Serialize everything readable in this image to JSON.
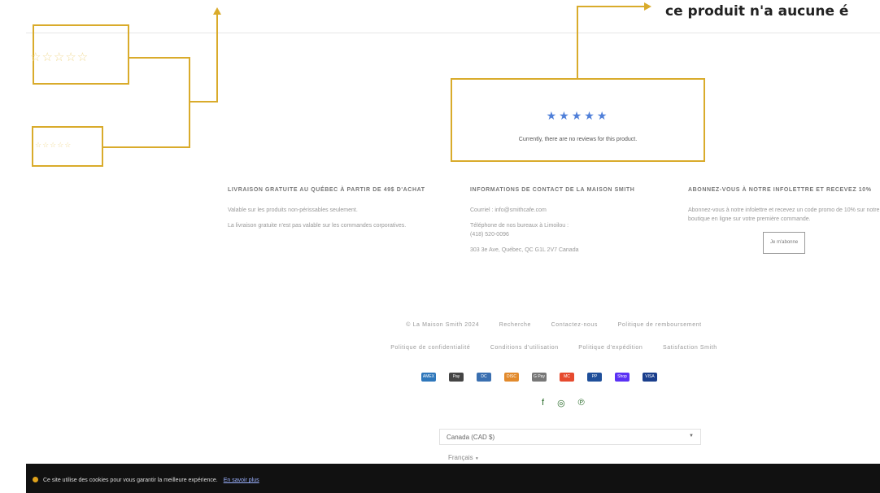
{
  "annotation": {
    "caption": "ce produit n'a aucune é",
    "star_rating_large": "☆☆☆☆☆",
    "star_rating_small": "☆☆☆☆☆",
    "color": "#d9ab2b"
  },
  "reviews": {
    "stars": "★★★★★",
    "empty_message": "Currently, there are no reviews for this product.",
    "star_color": "#4f7fd9"
  },
  "footer": {
    "shipping": {
      "heading": "Livraison gratuite au Québec à partir de 49$ d'achat",
      "line1": "Valable sur les produits non-périssables seulement.",
      "line2": "La livraison gratuite n'est pas valable sur les commandes corporatives."
    },
    "contact": {
      "heading": "Informations de contact de la Maison Smith",
      "email": "Courriel : info@smithcafe.com",
      "phone_label": "Téléphone de nos bureaux à Limoilou :",
      "phone": "(418) 520-0096",
      "address": "303 3e Ave, Québec, QC G1L 2V7 Canada"
    },
    "newsletter": {
      "heading": "Abonnez-vous à notre infolettre et recevez 10%",
      "text": "Abonnez-vous à notre infolettre et recevez un code promo de 10% sur notre boutique en ligne sur votre première commande.",
      "button": "Je m'abonne"
    },
    "links_row1": [
      "© La Maison Smith 2024",
      "Recherche",
      "Contactez-nous",
      "Politique de remboursement"
    ],
    "links_row2": [
      "Politique de confidentialité",
      "Conditions d'utilisation",
      "Politique d'expédition",
      "Satisfaction Smith"
    ],
    "payments": [
      {
        "name": "amex-icon",
        "label": "AMEX",
        "color": "#2e77bb"
      },
      {
        "name": "apple-pay-icon",
        "label": "Pay",
        "color": "#444444"
      },
      {
        "name": "diners-club-icon",
        "label": "DC",
        "color": "#3a6fb0"
      },
      {
        "name": "discover-icon",
        "label": "DISC",
        "color": "#e28a2c"
      },
      {
        "name": "google-pay-icon",
        "label": "G Pay",
        "color": "#777777"
      },
      {
        "name": "mastercard-icon",
        "label": "MC",
        "color": "#e64a2e"
      },
      {
        "name": "paypal-icon",
        "label": "PP",
        "color": "#1f4f9a"
      },
      {
        "name": "shop-pay-icon",
        "label": "Shop",
        "color": "#5a31f4"
      },
      {
        "name": "visa-icon",
        "label": "VISA",
        "color": "#1a3e8c"
      }
    ],
    "socials": [
      {
        "name": "facebook-icon",
        "glyph": "f"
      },
      {
        "name": "instagram-icon",
        "glyph": "◎"
      },
      {
        "name": "pinterest-icon",
        "glyph": "℗"
      }
    ],
    "currency": "Canada (CAD $)",
    "language": "Français"
  },
  "cookie_bar": {
    "text": "Ce site utilise des cookies pour vous garantir la meilleure expérience.",
    "link": "En savoir plus"
  }
}
